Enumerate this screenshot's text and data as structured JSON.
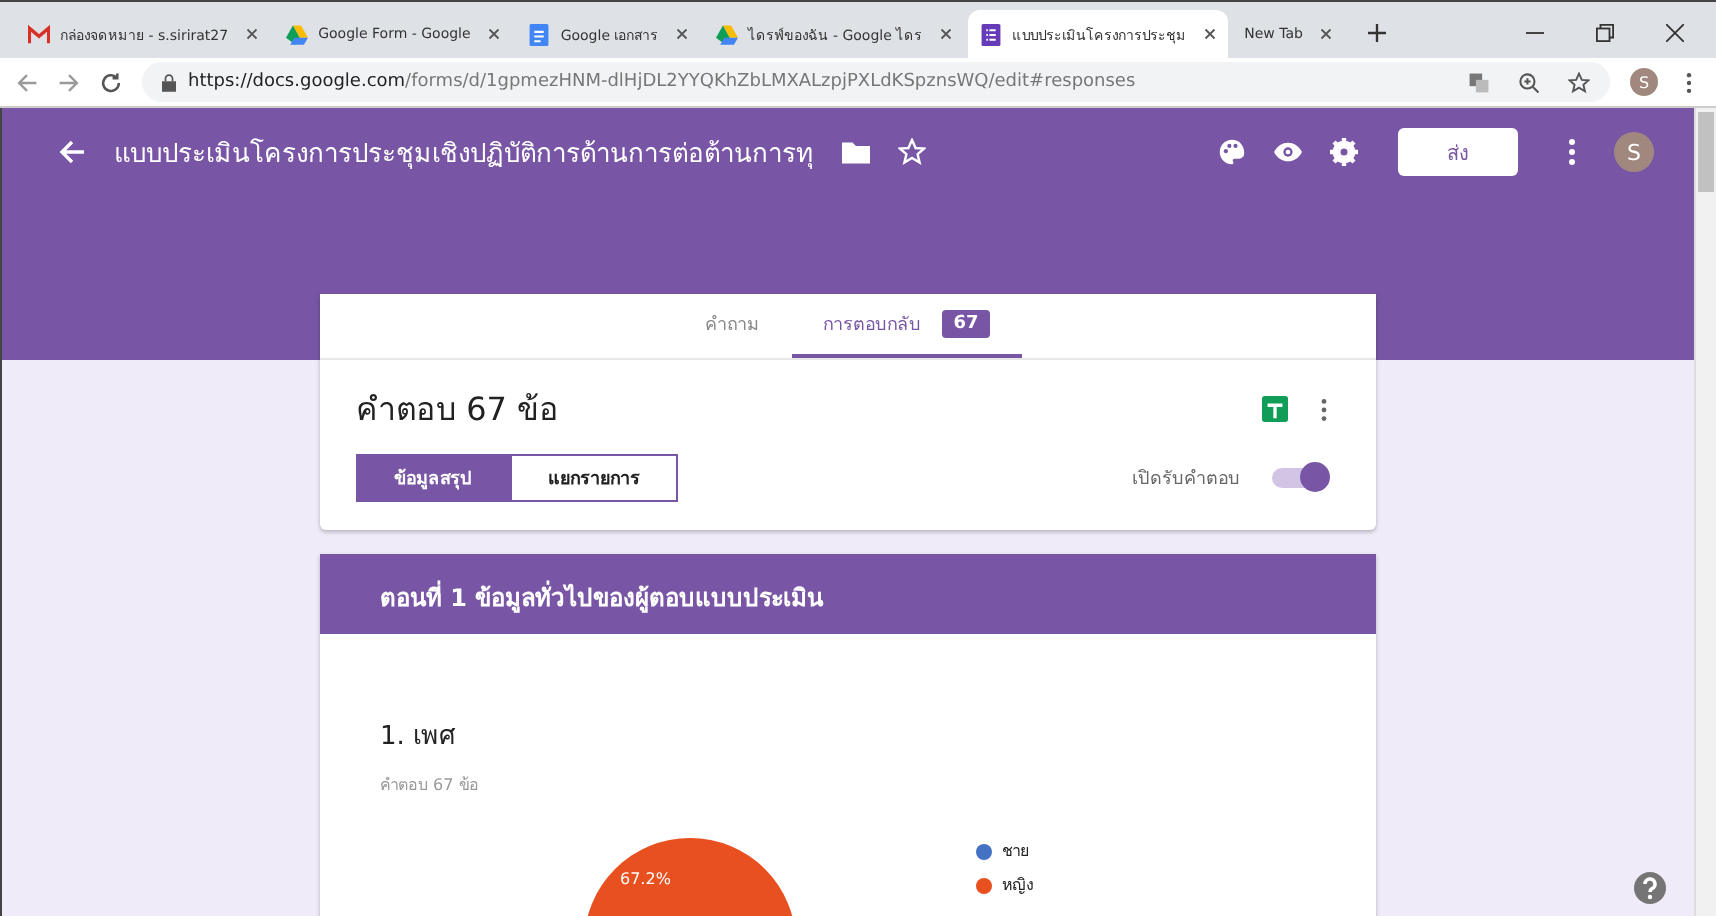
{
  "browser_tabs": [
    {
      "kind": "mail",
      "title": "กล่องจดหมาย - s.sirirat27",
      "selected": false
    },
    {
      "kind": "drive",
      "title": "Google Form - Google",
      "selected": false
    },
    {
      "kind": "docs",
      "title": "Google เอกสาร",
      "selected": false
    },
    {
      "kind": "drive",
      "title": "ไดรฟ์ของฉัน - Google ไดร",
      "selected": false
    },
    {
      "kind": "forms",
      "title": "แบบประเมินโครงการประชุม",
      "selected": true
    },
    {
      "kind": "blank",
      "title": "New Tab",
      "selected": false
    }
  ],
  "address": {
    "host": "https://docs.google.com",
    "path": "/forms/d/1gpmezHNM-dlHjDL2YYQKhZbLMXALzpjPXLdKSpznsWQ/edit#responses"
  },
  "browser_profile_initial": "S",
  "profile_initial": "S",
  "form_title": "แบบประเมินโครงการประชุมเชิงปฏิบัติการด้านการต่อต้านการทุ",
  "send_button": "ส่ง",
  "form_tabs": [
    {
      "label": "คำถาม",
      "selected": false
    },
    {
      "label": "การตอบกลับ",
      "selected": true,
      "badge": "67"
    }
  ],
  "responses_heading": "คำตอบ 67 ข้อ",
  "view_toggle": [
    {
      "label": "ข้อมูลสรุป",
      "selected": true
    },
    {
      "label": "แยกรายการ",
      "selected": false
    }
  ],
  "accepting": {
    "label": "เปิดรับคำตอบ",
    "on": true
  },
  "section_title": "ตอนที่ 1 ข้อมูลทั่วไปของผู้ตอบแบบประเมิน",
  "question": {
    "title": "1. เพศ",
    "count": "คำตอบ 67 ข้อ",
    "slice_label": "67.2%",
    "legend": [
      {
        "label": "ชาย",
        "color": "#4472c4"
      },
      {
        "label": "หญิง",
        "color": "#e8501f"
      }
    ]
  }
}
